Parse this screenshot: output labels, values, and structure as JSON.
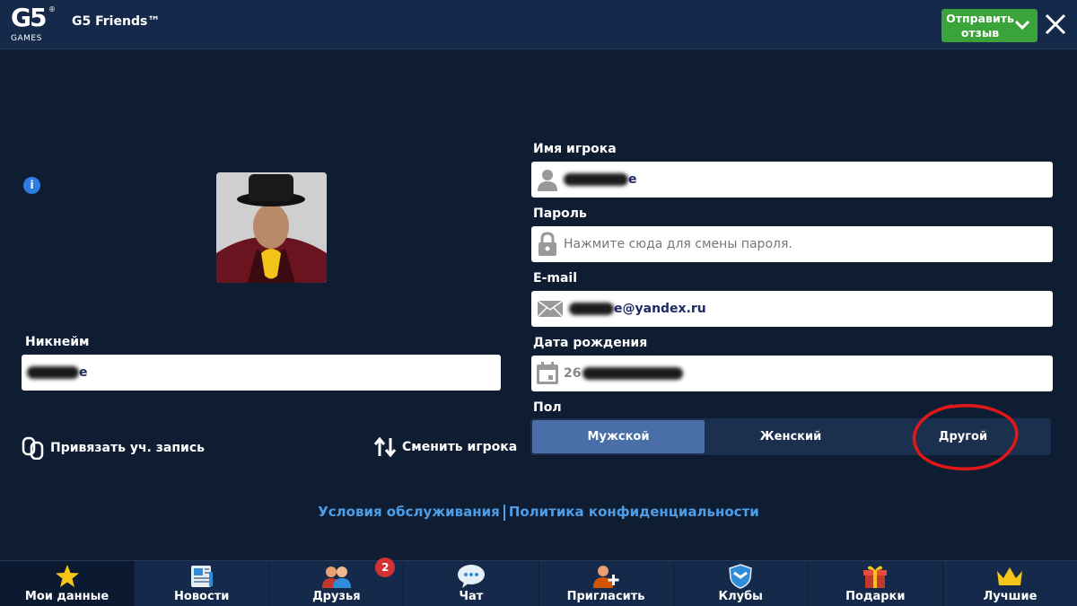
{
  "header": {
    "logo_text": "G5",
    "logo_sub": "GAMES",
    "logo_mark": "®",
    "title": "G5 Friends™",
    "feedback_label": "Отправить отзыв"
  },
  "profile": {
    "nickname_label": "Никнейм",
    "nickname_value_suffix": "e",
    "link_account": "Привязать уч. запись",
    "switch_player": "Сменить игрока"
  },
  "form": {
    "player_name_label": "Имя игрока",
    "player_name_suffix": "e",
    "password_label": "Пароль",
    "password_placeholder": "Нажмите сюда для смены пароля.",
    "email_label": "E-mail",
    "email_suffix": "e@yandex.ru",
    "birthdate_label": "Дата рождения",
    "birthdate_prefix": "26",
    "gender_label": "Пол",
    "gender_options": [
      "Мужской",
      "Женский",
      "Другой"
    ],
    "gender_selected": "Мужской"
  },
  "links": {
    "terms": "Условия обслуживания",
    "privacy": "Политика конфиденциальности"
  },
  "nav": {
    "items": [
      {
        "label": "Мои данные",
        "icon": "star-icon"
      },
      {
        "label": "Новости",
        "icon": "news-icon"
      },
      {
        "label": "Друзья",
        "icon": "friends-icon",
        "badge": "2"
      },
      {
        "label": "Чат",
        "icon": "chat-icon"
      },
      {
        "label": "Пригласить",
        "icon": "invite-icon"
      },
      {
        "label": "Клубы",
        "icon": "shield-icon"
      },
      {
        "label": "Подарки",
        "icon": "gift-icon"
      },
      {
        "label": "Лучшие",
        "icon": "crown-icon"
      }
    ],
    "active_index": 0
  },
  "colors": {
    "background": "#0f1d33",
    "header": "#15294a",
    "accent_green": "#3aa43a",
    "link_blue": "#4d9ee8",
    "selected_gender": "#4a6ea8",
    "badge_red": "#d23232",
    "annotation_red": "#e01818"
  }
}
